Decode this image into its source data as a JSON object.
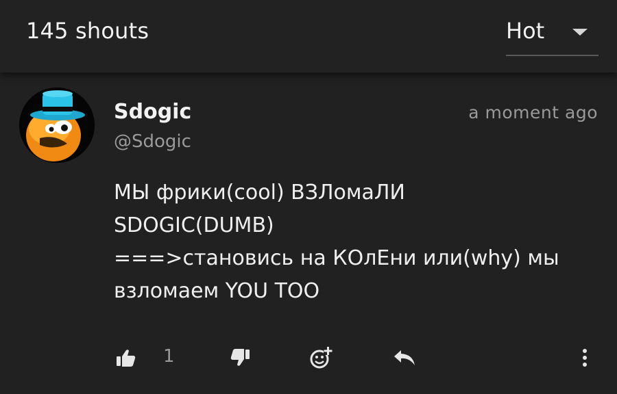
{
  "header": {
    "shout_count": "145 shouts",
    "sort": {
      "selected": "Hot"
    }
  },
  "comment": {
    "author_name": "Sdogic",
    "author_handle": "@Sdogic",
    "timestamp": "a moment ago",
    "text_lines": [
      "МЫ фрики(cool) ВЗЛомаЛИ",
      "SDOGIC(DUMB)",
      "===>становись на КОлЕни или(why) мы",
      "взломаем YOU TOO"
    ],
    "likes": "1",
    "actions": {
      "like_icon": "thumbs-up-icon",
      "dislike_icon": "thumbs-down-icon",
      "react_icon": "add-emoji-icon",
      "reply_icon": "reply-icon",
      "more_icon": "more-vertical-icon"
    }
  },
  "colors": {
    "background": "#212121",
    "text": "#f2f2f2",
    "muted": "#9a9a9a",
    "avatar_hat": "#2bbde0",
    "avatar_face": "#f7931e"
  }
}
